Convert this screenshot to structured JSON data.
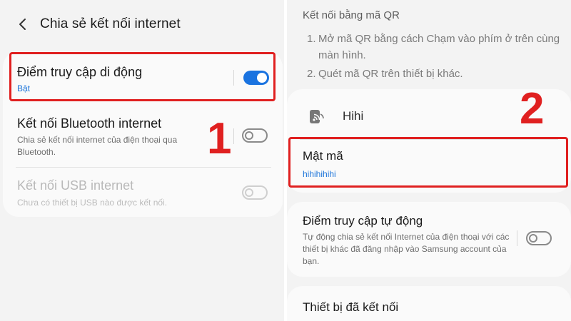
{
  "left": {
    "header": {
      "title": "Chia sẻ kết nối internet"
    },
    "items": [
      {
        "title": "Điểm truy cập di động",
        "subtitle": "Bật",
        "toggle": "on"
      },
      {
        "title": "Kết nối Bluetooth internet",
        "subtitle": "Chia sẻ kết nối internet của điện thoại qua Bluetooth.",
        "toggle": "off"
      },
      {
        "title": "Kết nối USB internet",
        "subtitle": "Chưa có thiết bị USB nào được kết nối.",
        "toggle": "disabled"
      }
    ],
    "step_label": "1"
  },
  "right": {
    "qr": {
      "title": "Kết nối bằng mã QR",
      "steps": [
        {
          "num": "1.",
          "text": "Mở mã QR bằng cách Chạm vào phím ở trên cùng màn hình."
        },
        {
          "num": "2.",
          "text": "Quét mã QR trên thiết bị khác."
        }
      ]
    },
    "network": {
      "icon": "hotspot-icon",
      "name": "Hihi",
      "password_label": "Mật mã",
      "password_value": "hihihihihi"
    },
    "auto_hotspot": {
      "title": "Điểm truy cập tự động",
      "subtitle": "Tự động chia sẻ kết nối Internet của điện thoại với các thiết bị khác đã đăng nhập vào Samsung account của bạn.",
      "toggle": "off"
    },
    "connected_devices": {
      "title": "Thiết bị đã kết nối"
    },
    "step_label": "2"
  },
  "colors": {
    "accent": "#1a73e0",
    "highlight": "#e02020",
    "background": "#f3f3f3",
    "card": "#fafafa"
  }
}
